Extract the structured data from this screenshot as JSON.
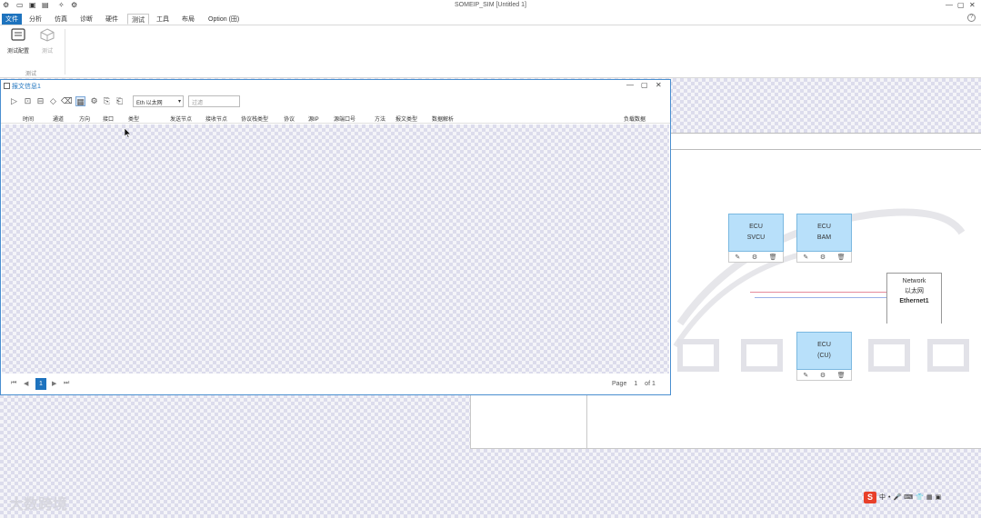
{
  "app": {
    "title": "SOMEIP_SIM [Untitled 1]",
    "win_controls": [
      "—",
      "▢",
      "✕"
    ]
  },
  "menu": {
    "file": "文件",
    "tabs": [
      "分析",
      "仿真",
      "诊断",
      "硬件",
      "测试",
      "工具",
      "布局",
      "Option (田)"
    ],
    "active": "测试"
  },
  "ribbon": {
    "buttons": [
      {
        "label": "测试配置",
        "icon": "test-config-icon"
      },
      {
        "label": "测试",
        "icon": "cube-icon"
      }
    ],
    "group_label": "测试"
  },
  "simulation": {
    "ecus": [
      {
        "title": "ECU",
        "name": "SVCU"
      },
      {
        "title": "ECU",
        "name": "BAM"
      },
      {
        "title": "ECU",
        "name": "(CU)"
      }
    ],
    "network": {
      "line1": "Network",
      "line2": "以太网",
      "line3": "Ethernet1"
    }
  },
  "dialog": {
    "title": "报文信息1",
    "controls": [
      "—",
      "▢",
      "✕"
    ],
    "channel_select": "Eth 以太网",
    "filter_placeholder": "过滤",
    "columns": [
      "时间",
      "通道",
      "方向",
      "接口",
      "类型",
      "发送节点",
      "接收节点",
      "协议栈类型",
      "协议",
      "源IP",
      "源端口号",
      "方法",
      "报文类型",
      "数据解析",
      "负载数据"
    ],
    "pager": {
      "current": "1",
      "page_label": "Page",
      "page_value": "1",
      "of_label": "of 1"
    }
  },
  "watermark": "大数跨境",
  "tray": {
    "ime": "S",
    "lang": "中"
  }
}
